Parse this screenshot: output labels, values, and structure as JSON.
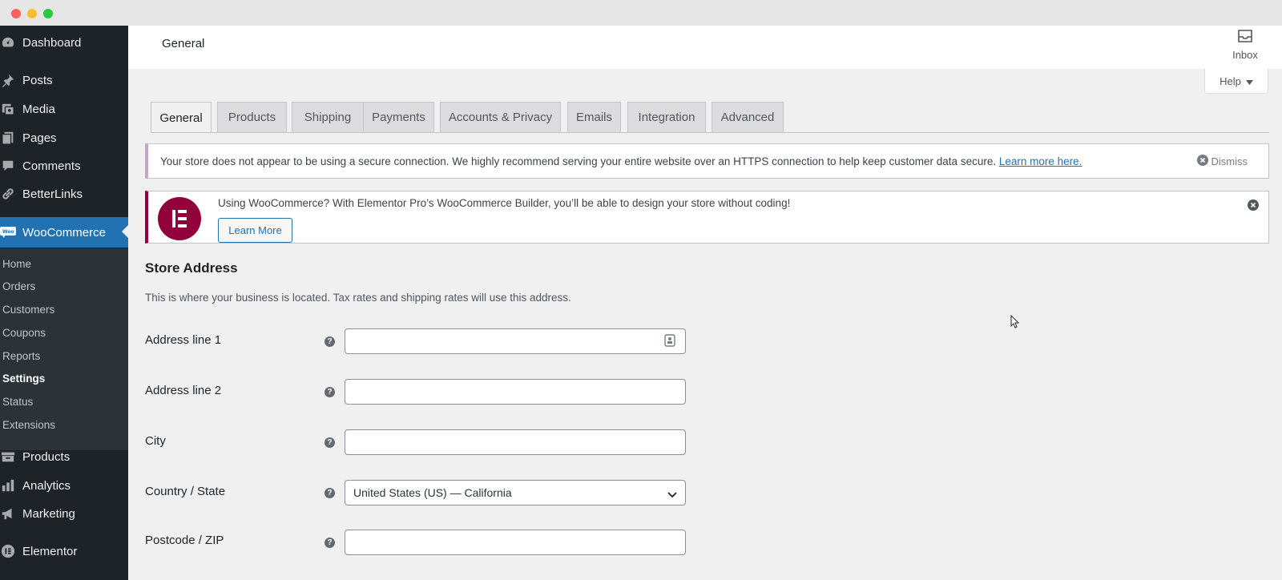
{
  "sidebar": {
    "items": [
      {
        "label": "Dashboard",
        "icon": "dashboard-icon"
      },
      {
        "label": "Posts",
        "icon": "pin-icon"
      },
      {
        "label": "Media",
        "icon": "media-icon"
      },
      {
        "label": "Pages",
        "icon": "pages-icon"
      },
      {
        "label": "Comments",
        "icon": "comment-icon"
      },
      {
        "label": "BetterLinks",
        "icon": "link-icon"
      },
      {
        "label": "WooCommerce",
        "icon": "woo-icon"
      }
    ],
    "submenu": [
      "Home",
      "Orders",
      "Customers",
      "Coupons",
      "Reports",
      "Settings",
      "Status",
      "Extensions"
    ],
    "submenu_current": "Settings",
    "bottom_items": [
      {
        "label": "Products",
        "icon": "archive-icon"
      },
      {
        "label": "Analytics",
        "icon": "bar-chart-icon"
      },
      {
        "label": "Marketing",
        "icon": "megaphone-icon"
      },
      {
        "label": "Elementor",
        "icon": "elementor-icon"
      }
    ]
  },
  "header": {
    "title": "General",
    "inbox_label": "Inbox"
  },
  "help_button": "Help",
  "tabs": [
    {
      "label": "General",
      "active": true
    },
    {
      "label": "Products",
      "active": false
    },
    {
      "label": "Shipping",
      "active": false
    },
    {
      "label": "Payments",
      "active": false
    },
    {
      "label": "Accounts & Privacy",
      "active": false
    },
    {
      "label": "Emails",
      "active": false
    },
    {
      "label": "Integration",
      "active": false
    },
    {
      "label": "Advanced",
      "active": false
    }
  ],
  "notice_https": {
    "text": "Your store does not appear to be using a secure connection. We highly recommend serving your entire website over an HTTPS connection to help keep customer data secure.",
    "link": "Learn more here.",
    "dismiss": "Dismiss"
  },
  "notice_elementor": {
    "text": "Using WooCommerce? With Elementor Pro’s WooCommerce Builder, you’ll be able to design your store without coding!",
    "button": "Learn More"
  },
  "store_address": {
    "title": "Store Address",
    "description": "This is where your business is located. Tax rates and shipping rates will use this address.",
    "fields": [
      {
        "label": "Address line 1",
        "value": ""
      },
      {
        "label": "Address line 2",
        "value": ""
      },
      {
        "label": "City",
        "value": ""
      },
      {
        "label": "Country / State",
        "value": "United States (US) — California"
      },
      {
        "label": "Postcode / ZIP",
        "value": ""
      }
    ]
  },
  "colors": {
    "sidebar_bg": "#1d2327",
    "submenu_bg": "#2c3338",
    "accent": "#2271b1",
    "elementor": "#92003b"
  }
}
